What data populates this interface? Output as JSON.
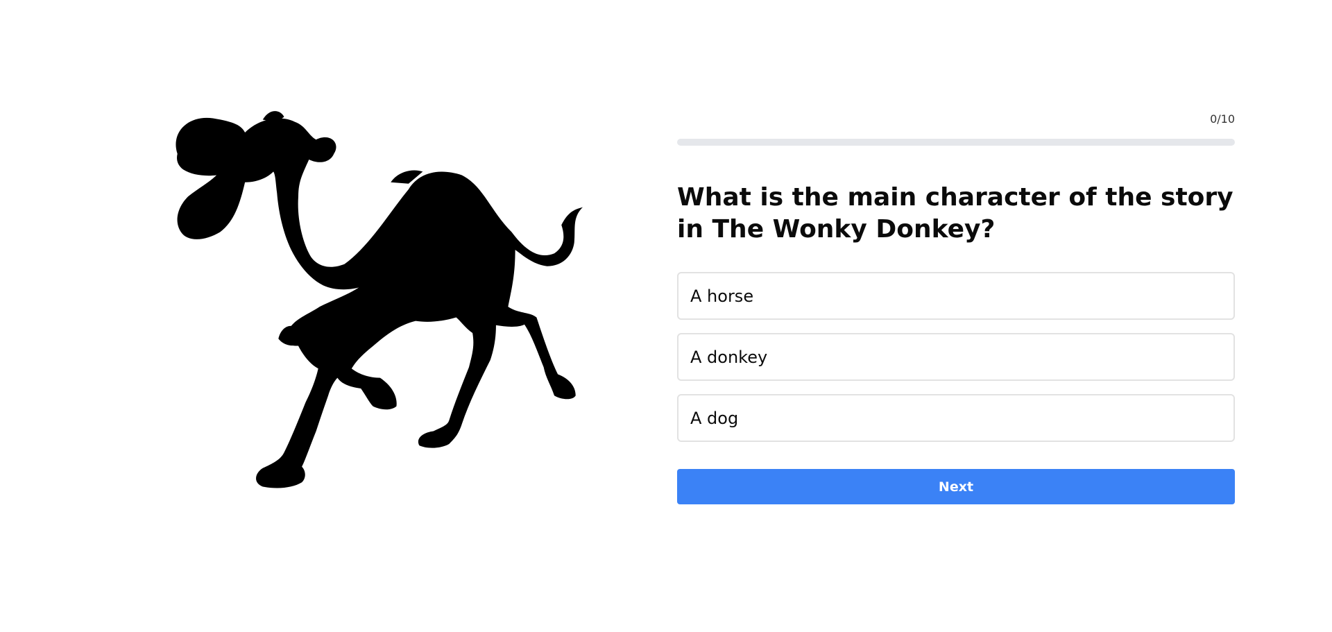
{
  "illustration": {
    "alt": "Camel silhouette"
  },
  "progress": {
    "label": "0/10",
    "fraction": 0,
    "fill_color": "#3b82f6",
    "track_color": "#e5e7eb"
  },
  "question": {
    "text": "What is the main character of the story in The Wonky Donkey?"
  },
  "options": [
    {
      "label": "A horse"
    },
    {
      "label": "A donkey"
    },
    {
      "label": "A dog"
    }
  ],
  "actions": {
    "next_label": "Next",
    "next_color": "#3b82f6"
  }
}
